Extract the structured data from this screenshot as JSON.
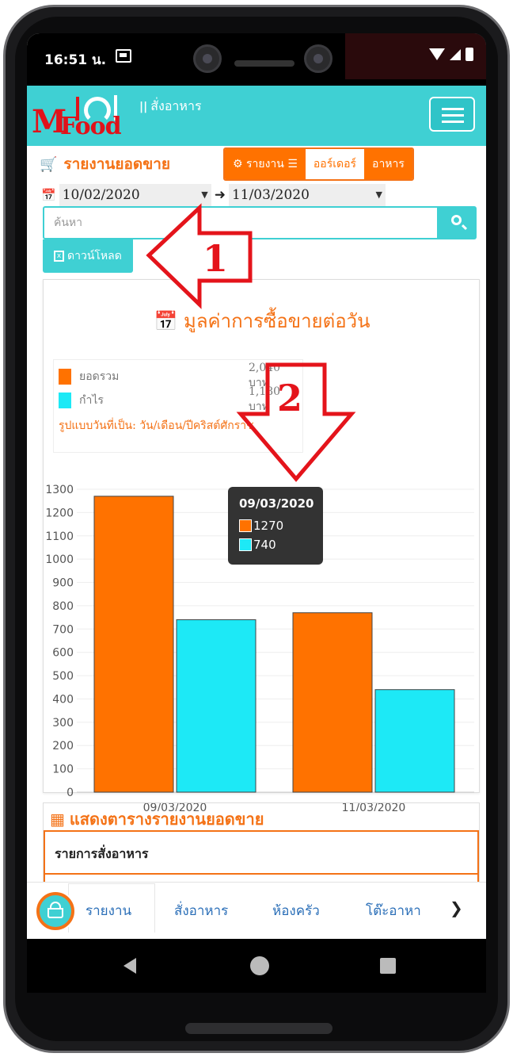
{
  "status_bar": {
    "time": "16:51 น."
  },
  "header": {
    "logo_text_m": "M",
    "logo_text_food": "Food",
    "subtitle": "สั่งอาหาร"
  },
  "report": {
    "title": "รายงานยอดขาย",
    "tabs": [
      "รายงาน",
      "ออร์เดอร์",
      "อาหาร"
    ]
  },
  "filters": {
    "date_from": "10/02/2020",
    "date_to": "11/03/2020",
    "search_placeholder": "ค้นหา",
    "download_label": "ดาวน์โหลด"
  },
  "annotations": {
    "arrow1": "1",
    "arrow2": "2"
  },
  "chart_card": {
    "title": "มูลค่าการซื้อขายต่อวัน",
    "legend": [
      {
        "label": "ยอดรวม",
        "value": "2,040 บาท",
        "color": "#ff7200"
      },
      {
        "label": "กำไร",
        "value": "1,180 บาท",
        "color": "#1de9f6"
      }
    ],
    "date_format_note": "รูปแบบวันที่เป็น: วัน/เดือน/ปีคริสต์ศักราช",
    "tooltip": {
      "title": "09/03/2020",
      "values": [
        "1270",
        "740"
      ]
    }
  },
  "chart_data": {
    "type": "bar",
    "categories": [
      "09/03/2020",
      "11/03/2020"
    ],
    "series": [
      {
        "name": "ยอดรวม",
        "values": [
          1270,
          770
        ],
        "color": "#ff7200"
      },
      {
        "name": "กำไร",
        "values": [
          740,
          440
        ],
        "color": "#1de9f6"
      }
    ],
    "ylim": [
      0,
      1300
    ],
    "yticks": [
      0,
      100,
      200,
      300,
      400,
      500,
      600,
      700,
      800,
      900,
      1000,
      1100,
      1200,
      1300
    ],
    "grid": true
  },
  "table_card": {
    "title": "แสดงตารางรายงานยอดขาย",
    "header": "รายการสั่งอาหาร"
  },
  "bottom_nav": {
    "items": [
      "รายงาน",
      "สั่งอาหาร",
      "ห้องครัว",
      "โต๊ะอาหา"
    ]
  }
}
